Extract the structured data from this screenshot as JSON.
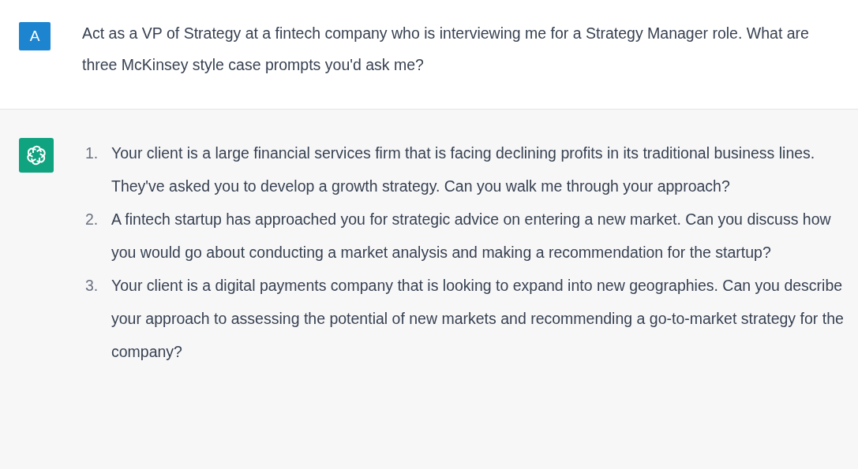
{
  "conversation": [
    {
      "kind": "user",
      "avatar": "A",
      "text": "Act as a VP of Strategy at a fintech company who is interviewing me for a Strategy Manager role. What are three McKinsey style case prompts you'd ask me?"
    },
    {
      "kind": "assistant",
      "items": [
        {
          "number": "1.",
          "text": "Your client is a large financial services firm that is facing declining profits in its traditional business lines. They've asked you to develop a growth strategy. Can you walk me through your approach?"
        },
        {
          "number": "2.",
          "text": "A fintech startup has approached you for strategic advice on entering a new market. Can you discuss how you would go about conducting a market analysis and making a recommendation for the startup?"
        },
        {
          "number": "3.",
          "text": "Your client is a digital payments company that is looking to expand into new geographies. Can you describe your approach to assessing the potential of new markets and recommending a go-to-market strategy for the company?"
        }
      ]
    }
  ]
}
